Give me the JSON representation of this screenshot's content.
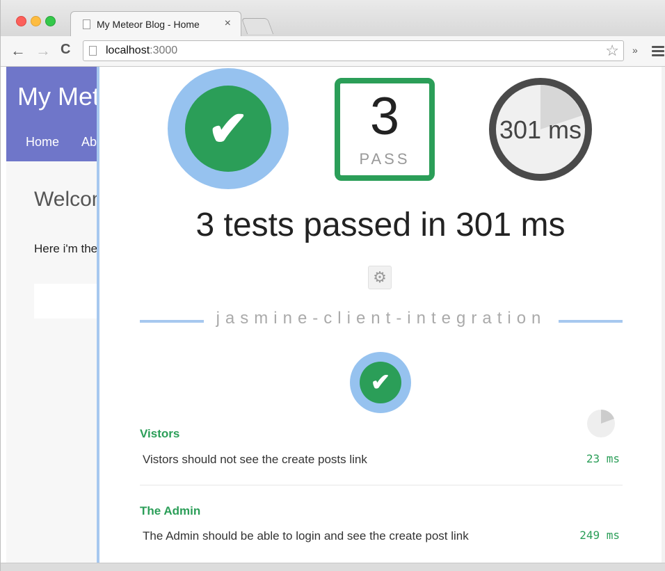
{
  "browser": {
    "tab_title": "My Meteor Blog - Home",
    "tab_close": "×",
    "url_host": "localhost",
    "url_port": ":3000",
    "overflow": "»"
  },
  "site": {
    "title": "My Meteor Blog",
    "nav": {
      "home": "Home",
      "about": "About"
    },
    "welcome": "Welcome",
    "intro": "Here i'm the"
  },
  "velocity": {
    "pass_count": "3",
    "pass_label": "PASS",
    "timer": "301 ms",
    "summary": "3 tests passed in 301 ms",
    "framework": "jasmine-client-integration",
    "suites": [
      {
        "name": "Vistors",
        "test": "Vistors should not see the create posts link",
        "time": "23 ms"
      },
      {
        "name": "The Admin",
        "test": "The Admin should be able to login and see the create post link",
        "time": "249 ms"
      }
    ],
    "colors": {
      "pass_green": "#2b9e58",
      "ring_blue": "#96c2ef"
    }
  },
  "icons": {
    "check": "✔",
    "gear": "⚙",
    "back": "←",
    "forward": "→",
    "reload": "C",
    "star": "☆"
  }
}
